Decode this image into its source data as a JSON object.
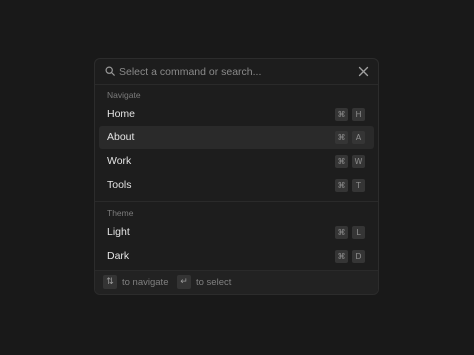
{
  "search": {
    "placeholder": "Select a command or search...",
    "value": ""
  },
  "groups": [
    {
      "label": "Navigate",
      "items": [
        {
          "label": "Home",
          "modifier": "⌘",
          "key": "H"
        },
        {
          "label": "About",
          "modifier": "⌘",
          "key": "A"
        },
        {
          "label": "Work",
          "modifier": "⌘",
          "key": "W"
        },
        {
          "label": "Tools",
          "modifier": "⌘",
          "key": "T"
        }
      ]
    },
    {
      "label": "Theme",
      "items": [
        {
          "label": "Light",
          "modifier": "⌘",
          "key": "L"
        },
        {
          "label": "Dark",
          "modifier": "⌘",
          "key": "D"
        }
      ]
    }
  ],
  "active_item": "About",
  "footer": {
    "navigate_key": "⇅",
    "navigate_text": "to navigate",
    "select_key": "↵",
    "select_text": "to select"
  },
  "colors": {
    "background": "#191919",
    "panel": "#1d1d1d",
    "active_row": "#2a2a2a",
    "text": "#e4e4e4",
    "muted_text": "#7c7c7c"
  }
}
